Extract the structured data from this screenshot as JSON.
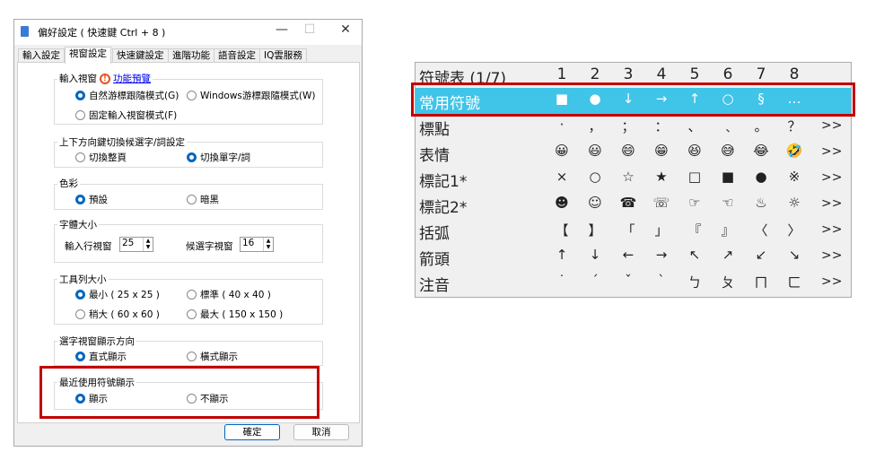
{
  "window": {
    "title": "偏好設定 ( 快速鍵 Ctrl + 8 )",
    "minimize": "—",
    "maximize": "☐",
    "close": "✕"
  },
  "tabs": [
    {
      "label": "輸入設定"
    },
    {
      "label": "視窗設定",
      "active": true
    },
    {
      "label": "快速鍵設定"
    },
    {
      "label": "進階功能"
    },
    {
      "label": "語音設定"
    },
    {
      "label": "IQ雲服務"
    }
  ],
  "groups": {
    "input_window": {
      "legend": "輸入視窗",
      "link": "功能預覽",
      "options": [
        "自然游標跟隨模式(G)",
        "Windows游標跟隨模式(W)",
        "固定輸入視窗模式(F)"
      ],
      "selected": 0
    },
    "updown": {
      "legend": "上下方向鍵切換候選字/詞設定",
      "options": [
        "切換整頁",
        "切換單字/詞"
      ],
      "selected": 1
    },
    "color": {
      "legend": "色彩",
      "options": [
        "預設",
        "暗黑"
      ],
      "selected": 0
    },
    "font_size": {
      "legend": "字體大小",
      "input_label": "輸入行視窗",
      "input_value": "25",
      "cand_label": "候選字視窗",
      "cand_value": "16"
    },
    "toolbar": {
      "legend": "工具列大小",
      "options": [
        "最小 ( 25 x 25 )",
        "標準 ( 40 x 40 )",
        "稍大 ( 60 x 60 )",
        "最大 ( 150 x 150 )"
      ],
      "selected": 0
    },
    "direction": {
      "legend": "選字視窗顯示方向",
      "options": [
        "直式顯示",
        "橫式顯示"
      ],
      "selected": 0
    },
    "recent": {
      "legend": "最近使用符號顯示",
      "options": [
        "顯示",
        "不顯示"
      ],
      "selected": 0
    }
  },
  "buttons": {
    "ok": "確定",
    "cancel": "取消"
  },
  "symbol_table": {
    "header": {
      "label": "符號表 (1/7)",
      "cols": [
        "1",
        "2",
        "3",
        "4",
        "5",
        "6",
        "7",
        "8"
      ]
    },
    "more": ">>",
    "highlight_color": "#40c4e8",
    "rows": [
      {
        "label": "常用符號",
        "cells": [
          "■",
          "●",
          "↓",
          "→",
          "↑",
          "○",
          "§",
          "…"
        ],
        "highlighted": true
      },
      {
        "label": "標點",
        "cells": [
          "·",
          "，",
          "；",
          "：",
          "、",
          "﹑",
          "。",
          "？"
        ]
      },
      {
        "label": "表情",
        "cells": [
          "😀",
          "😃",
          "😄",
          "😁",
          "😆",
          "😅",
          "😂",
          "🤣"
        ]
      },
      {
        "label": "標記1*",
        "cells": [
          "×",
          "○",
          "☆",
          "★",
          "□",
          "■",
          "●",
          "※"
        ]
      },
      {
        "label": "標記2*",
        "cells": [
          "☻",
          "☺",
          "☎",
          "☏",
          "☞",
          "☜",
          "♨",
          "☼"
        ]
      },
      {
        "label": "括弧",
        "cells": [
          "【",
          "】",
          "「",
          "」",
          "『",
          "』",
          "〈",
          "〉"
        ]
      },
      {
        "label": "箭頭",
        "cells": [
          "↑",
          "↓",
          "←",
          "→",
          "↖",
          "↗",
          "↙",
          "↘"
        ]
      },
      {
        "label": "注音",
        "cells": [
          "˙",
          "ˊ",
          "ˇ",
          "ˋ",
          "ㄅ",
          "ㄆ",
          "ㄇ",
          "ㄈ"
        ]
      }
    ]
  }
}
